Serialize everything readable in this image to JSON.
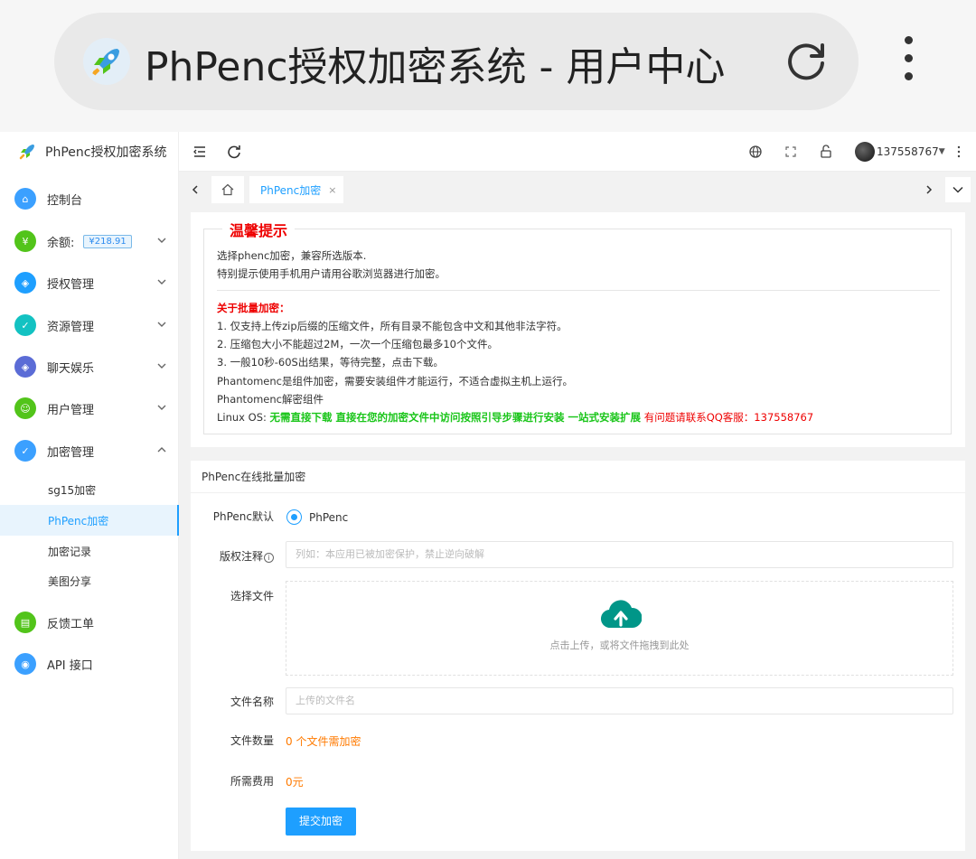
{
  "browser": {
    "title": "PhPenc授权加密系统 - 用户中心",
    "logo_icon": "rocket-icon",
    "reload_icon": "reload-icon",
    "menu_icon": "more-vertical-icon"
  },
  "sidebar": {
    "brand": "PhPenc授权加密系统",
    "items": [
      {
        "label": "控制台",
        "icon": "home-icon",
        "color": "#3ba0ff"
      },
      {
        "label": "余额:",
        "icon": "yen-icon",
        "color": "#52c41a",
        "badge": "¥218.91"
      },
      {
        "label": "授权管理",
        "icon": "shield-icon",
        "color": "#1e9fff"
      },
      {
        "label": "资源管理",
        "icon": "shield-check-icon",
        "color": "#13c2c2"
      },
      {
        "label": "聊天娱乐",
        "icon": "shield-icon",
        "color": "#5b6cd6"
      },
      {
        "label": "用户管理",
        "icon": "users-icon",
        "color": "#52c41a"
      },
      {
        "label": "加密管理",
        "icon": "shield-check-icon",
        "color": "#3ba0ff"
      },
      {
        "label": "反馈工单",
        "icon": "ticket-icon",
        "color": "#52c41a"
      },
      {
        "label": "API 接口",
        "icon": "api-icon",
        "color": "#3ba0ff"
      }
    ],
    "sub_items": [
      "sg15加密",
      "PhPenc加密",
      "加密记录",
      "美图分享"
    ]
  },
  "topbar": {
    "username": "137558767",
    "icons": [
      "collapse-menu-icon",
      "refresh-icon",
      "globe-icon",
      "fullscreen-icon",
      "lock-icon",
      "more-vertical-icon"
    ]
  },
  "tabs": {
    "home_icon": "home-icon",
    "active": "PhPenc加密",
    "close": "×"
  },
  "notice": {
    "title": "温馨提示",
    "line1": "选择phenc加密，兼容所选版本.",
    "line2": "特别提示使用手机用户请用谷歌浏览器进行加密。",
    "batch_title": "关于批量加密：",
    "rule1": "1. 仅支持上传zip后缀的压缩文件，所有目录不能包含中文和其他非法字符。",
    "rule2": "2. 压缩包大小不能超过2M，一次一个压缩包最多10个文件。",
    "rule3": "3. 一般10秒-60S出结果，等待完整，点击下载。",
    "rule4": "Phantomenc是组件加密，需要安装组件才能运行，不适合虚拟主机上运行。",
    "rule5": "Phantomenc解密组件",
    "linux_prefix": "Linux OS: ",
    "linux_green": "无需直接下载 直接在您的加密文件中访问按照引导步骤进行安装 一站式安装扩展",
    "linux_red": " 有问题请联系QQ客服：137558767"
  },
  "form": {
    "header": "PhPenc在线批量加密",
    "default_label": "PhPenc默认",
    "radio_option": "PhPenc",
    "copyright_label": "版权注释",
    "copyright_placeholder": "列如：本应用已被加密保护，禁止逆向破解",
    "file_label": "选择文件",
    "upload_hint": "点击上传，或将文件拖拽到此处",
    "filename_label": "文件名称",
    "filename_placeholder": "上传的文件名",
    "count_label": "文件数量",
    "count_value": "0 个文件需加密",
    "fee_label": "所需费用",
    "fee_value": "0元",
    "submit": "提交加密"
  }
}
